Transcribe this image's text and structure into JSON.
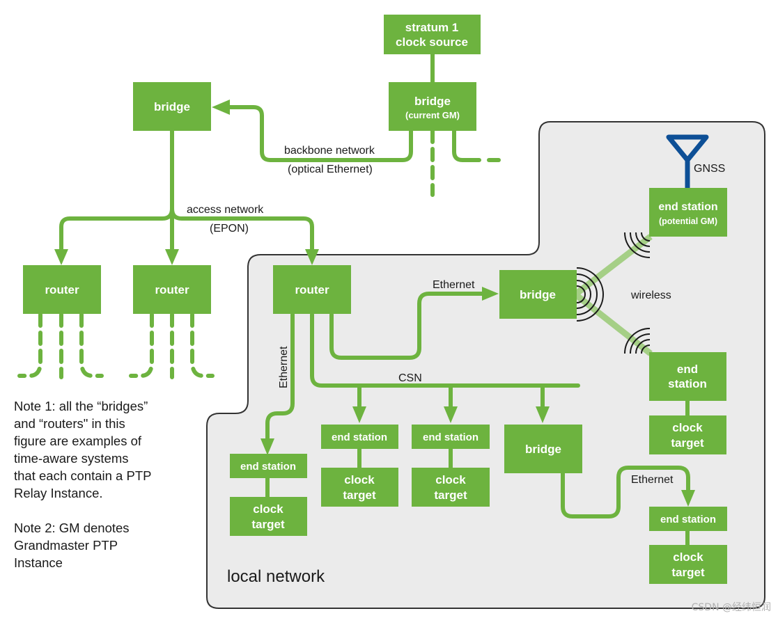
{
  "nodes": {
    "stratum": {
      "line1": "stratum 1",
      "line2": "clock source"
    },
    "gm_bridge": {
      "line1": "bridge",
      "line2": "(current GM)"
    },
    "bridge_top_left": {
      "label": "bridge"
    },
    "router_1": {
      "label": "router"
    },
    "router_2": {
      "label": "router"
    },
    "router_local": {
      "label": "router"
    },
    "bridge_wireless": {
      "label": "bridge"
    },
    "end_station_gm": {
      "line1": "end station",
      "line2": "(potential GM)"
    },
    "end_station_wireless": {
      "line1": "end",
      "line2": "station"
    },
    "clock_target_wireless": {
      "line1": "clock",
      "line2": "target"
    },
    "end_station_eth": {
      "label": "end station"
    },
    "clock_target_eth": {
      "line1": "clock",
      "line2": "target"
    },
    "end_station_csn1": {
      "label": "end station"
    },
    "clock_target_csn1": {
      "line1": "clock",
      "line2": "target"
    },
    "end_station_csn2": {
      "label": "end station"
    },
    "clock_target_csn2": {
      "line1": "clock",
      "line2": "target"
    },
    "bridge_csn": {
      "label": "bridge"
    },
    "end_station_br": {
      "label": "end station"
    },
    "clock_target_br": {
      "line1": "clock",
      "line2": "target"
    }
  },
  "labels": {
    "backbone": "backbone network",
    "backbone_sub": "(optical Ethernet)",
    "access": "access network",
    "access_sub": "(EPON)",
    "ethernet_top": "Ethernet",
    "ethernet_vertical": "Ethernet",
    "csn": "CSN",
    "wireless": "wireless",
    "gnss": "GNSS",
    "ethernet_bottom": "Ethernet",
    "local_network": "local network"
  },
  "notes": {
    "note1": "Note 1: all the “bridges”\nand “routers\" in this\nfigure are examples of\ntime-aware systems\nthat each contain a PTP\nRelay Instance.",
    "note2": "Note 2: GM denotes\nGrandmaster PTP\nInstance"
  },
  "watermark": "CSDN @经纬恒润",
  "colors": {
    "node": "#6db33f",
    "antenna": "#0d4f96",
    "local_bg": "#ebebeb",
    "wireless_link": "#a5cf86"
  }
}
